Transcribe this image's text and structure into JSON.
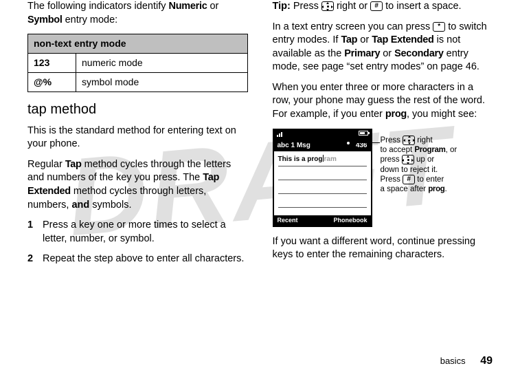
{
  "watermark": "DRAFT",
  "left": {
    "intro_pre": "The following indicators identify ",
    "intro_b1": "Numeric",
    "intro_mid": " or ",
    "intro_b2": "Symbol",
    "intro_post": " entry mode:",
    "table_header": "non-text entry mode",
    "row1_icon": "123",
    "row1_label": "numeric mode",
    "row2_icon": "@%",
    "row2_label": "symbol mode",
    "heading": "tap method",
    "para1": "This is the standard method for entering text on your phone.",
    "para2_pre": "Regular ",
    "para2_b1": "Tap",
    "para2_mid1": " method cycles through the letters and numbers of the key you press. The ",
    "para2_b2": "Tap Extended",
    "para2_mid2": " method cycles through letters, numbers, ",
    "para2_b3": "and",
    "para2_post": " symbols.",
    "step1": "Press a key one or more times to select a letter, number, or symbol.",
    "step2": "Repeat the step above to enter all characters."
  },
  "right": {
    "tip_label": "Tip:",
    "tip_pre": " Press ",
    "tip_mid1": " right or ",
    "hash_key": "#",
    "tip_post": " to insert a space.",
    "p2_pre": "In a text entry screen you can press ",
    "star_key": "*",
    "p2_mid1": " to switch entry modes. If ",
    "p2_b1": "Tap",
    "p2_mid2": " or ",
    "p2_b2": "Tap Extended",
    "p2_mid3": " is not available as the ",
    "p2_b3": "Primary",
    "p2_mid4": " or ",
    "p2_b4": "Secondary",
    "p2_mid5": " entry mode, see page “set entry modes” on page 46.",
    "p3_pre": "When you enter three or more characters in a row, your phone may guess the rest of the word. For example, if you enter ",
    "p3_b1": "prog",
    "p3_post": ", you might see:",
    "phone": {
      "title_left": "abc 1 Msg",
      "title_right": "436",
      "typed": "This is a prog",
      "ghost": "ram",
      "soft_left": "Recent",
      "soft_right": "Phonebook"
    },
    "callout": {
      "l1_pre": "Press ",
      "l1_post": " right",
      "l2_pre": "to accept ",
      "l2_b": "Program",
      "l2_post": ", or",
      "l3_pre": "press ",
      "l3_post": " up or",
      "l4": "down to reject it.",
      "l5_pre": "Press ",
      "l5_post": " to enter",
      "l6_pre": "a space after ",
      "l6_b": "prog",
      "l6_post": "."
    },
    "p4": "If you want a different word, continue pressing keys to enter the remaining characters."
  },
  "footer": {
    "section": "basics",
    "page": "49"
  }
}
